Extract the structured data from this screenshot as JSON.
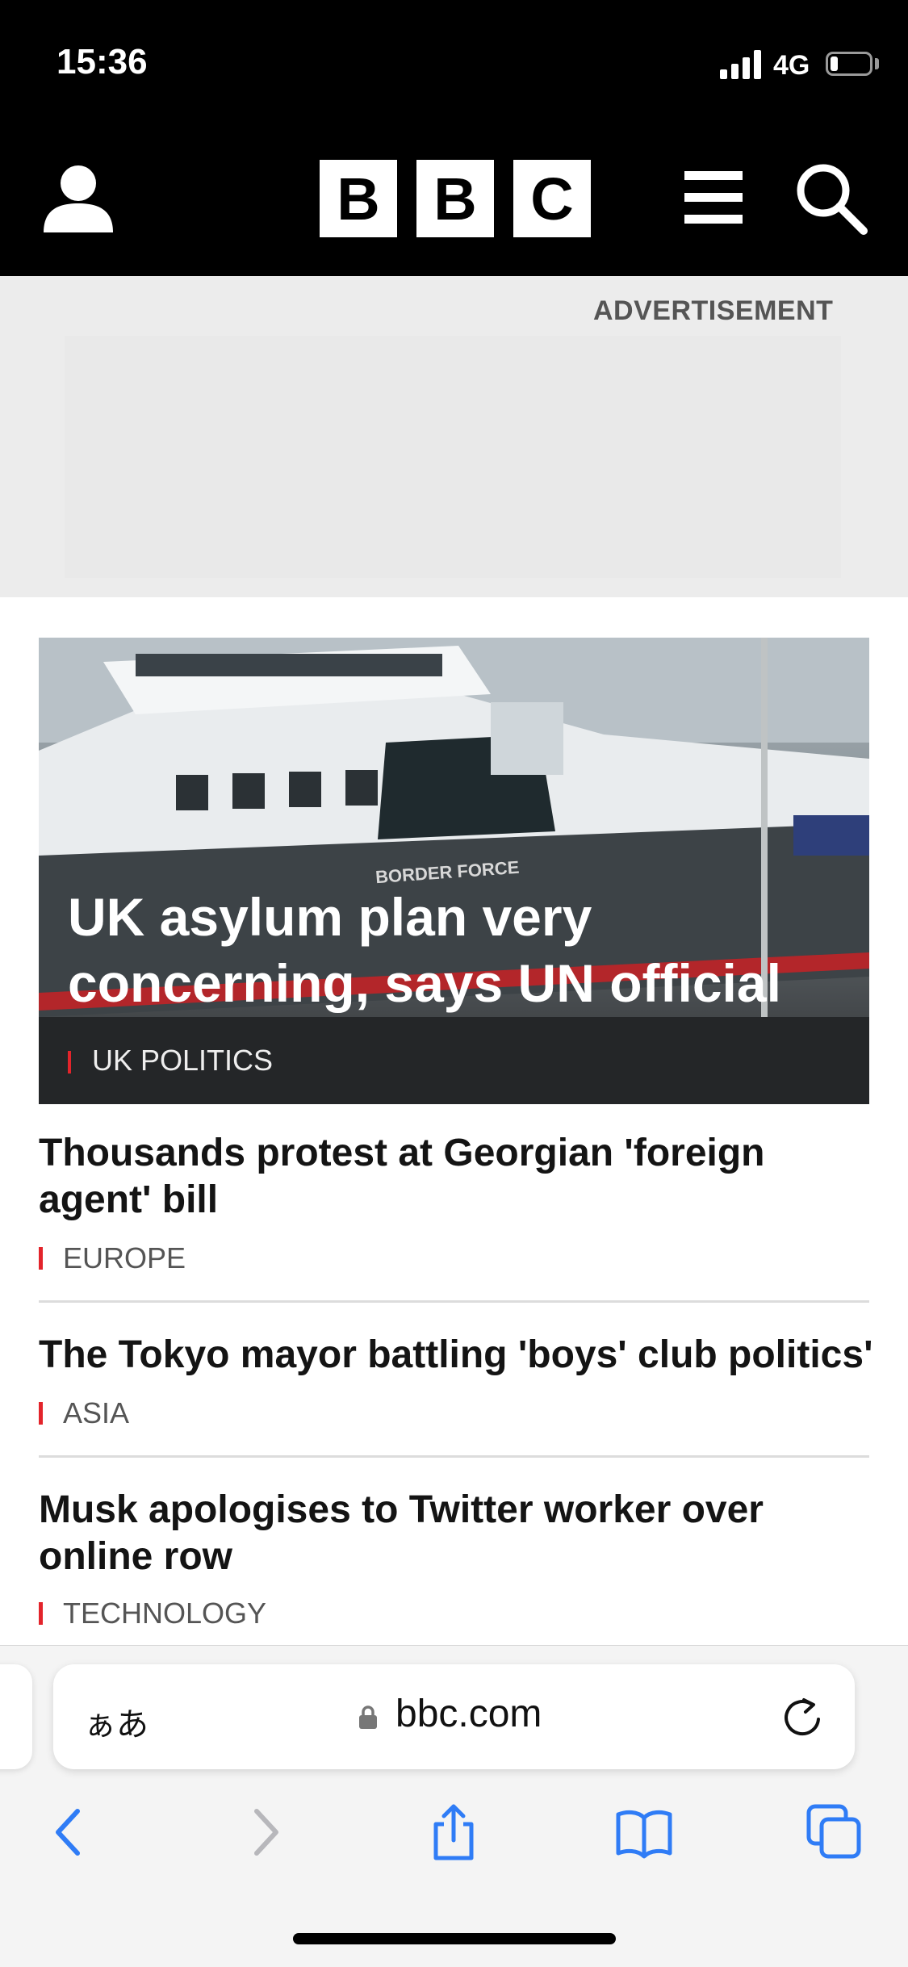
{
  "status_bar": {
    "time": "15:36",
    "network": "4G"
  },
  "header": {
    "logo_letters": [
      "B",
      "B",
      "C"
    ]
  },
  "ad": {
    "label": "ADVERTISEMENT"
  },
  "hero": {
    "title": "UK asylum plan very concerning, says UN official",
    "tag": "UK POLITICS",
    "image_text": "BORDER FORCE"
  },
  "stories": [
    {
      "title": "Thousands protest at Georgian 'foreign agent' bill",
      "tag": "EUROPE"
    },
    {
      "title": "The Tokyo mayor battling 'boys' club politics'",
      "tag": "ASIA"
    },
    {
      "title": "Musk apologises to Twitter worker over online row",
      "tag": "TECHNOLOGY"
    }
  ],
  "browser": {
    "text_size_label": "ぁあ",
    "url": "bbc.com"
  },
  "icons": {
    "account": "user-icon",
    "menu": "hamburger-icon",
    "search": "search-icon",
    "back": "chevron-left-icon",
    "forward": "chevron-right-icon",
    "share": "share-icon",
    "bookmarks": "book-icon",
    "tabs": "tabs-icon",
    "lock": "lock-icon",
    "reload": "reload-icon"
  },
  "colors": {
    "accent_red": "#e3242b",
    "header_bg": "#000000",
    "ios_blue": "#2f7cf6"
  }
}
